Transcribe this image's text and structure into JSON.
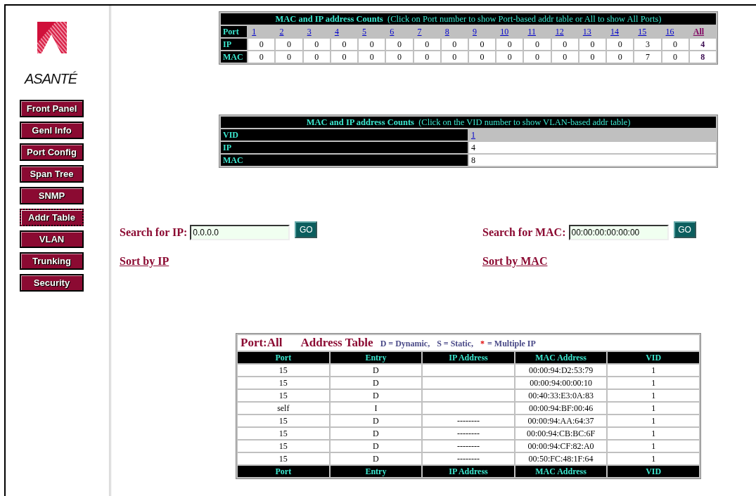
{
  "sidebar": {
    "brand": "ASANTÉ",
    "items": [
      {
        "label": "Front Panel",
        "selected": false
      },
      {
        "label": "Genl Info",
        "selected": false
      },
      {
        "label": "Port Config",
        "selected": false
      },
      {
        "label": "Span Tree",
        "selected": false
      },
      {
        "label": "SNMP",
        "selected": false
      },
      {
        "label": "Addr Table",
        "selected": true
      },
      {
        "label": "VLAN",
        "selected": false
      },
      {
        "label": "Trunking",
        "selected": false
      },
      {
        "label": "Security",
        "selected": false
      }
    ]
  },
  "port_counts": {
    "title": "MAC and IP address Counts",
    "note": "(Click on Port number to show Port-based addr table or All to show All Ports)",
    "header": "Port",
    "ports": [
      "1",
      "2",
      "3",
      "4",
      "5",
      "6",
      "7",
      "8",
      "9",
      "10",
      "11",
      "12",
      "13",
      "14",
      "15",
      "16"
    ],
    "all": "All",
    "rows": [
      {
        "label": "IP",
        "values": [
          "0",
          "0",
          "0",
          "0",
          "0",
          "0",
          "0",
          "0",
          "0",
          "0",
          "0",
          "0",
          "0",
          "0",
          "3",
          "0"
        ],
        "total": "4"
      },
      {
        "label": "MAC",
        "values": [
          "0",
          "0",
          "0",
          "0",
          "0",
          "0",
          "0",
          "0",
          "0",
          "0",
          "0",
          "0",
          "0",
          "0",
          "7",
          "0"
        ],
        "total": "8"
      }
    ]
  },
  "vlan_counts": {
    "title": "MAC and IP address Counts",
    "note": "(Click on the VID number to show VLAN-based addr table)",
    "rows": [
      {
        "label": "VID",
        "value": "1",
        "kind": "link"
      },
      {
        "label": "IP",
        "value": "4",
        "kind": "plain"
      },
      {
        "label": "MAC",
        "value": "8",
        "kind": "plain"
      }
    ]
  },
  "search": [
    {
      "label": "Search for IP:",
      "value": "0.0.0.0",
      "button": "GO",
      "sort_link": "Sort by IP"
    },
    {
      "label": "Search for MAC:",
      "value": "00:00:00:00:00:00",
      "button": "GO",
      "sort_link": "Sort by MAC"
    }
  ],
  "address_table": {
    "port": "Port:All",
    "title": "Address Table",
    "legend": [
      {
        "text": "D = Dynamic,"
      },
      {
        "text": "S = Static,"
      },
      {
        "mark": "*",
        "text": "= Multiple IP"
      }
    ],
    "columns": [
      "Port",
      "Entry",
      "IP Address",
      "MAC Address",
      "VID"
    ],
    "rows": [
      [
        "15",
        "D",
        "",
        "00:00:94:D2:53:79",
        "1"
      ],
      [
        "15",
        "D",
        "",
        "00:00:94:00:00:10",
        "1"
      ],
      [
        "15",
        "D",
        "",
        "00:40:33:E3:0A:83",
        "1"
      ],
      [
        "self",
        "I",
        "",
        "00:00:94:BF:00:46",
        "1"
      ],
      [
        "15",
        "D",
        "--------",
        "00:00:94:AA:64:37",
        "1"
      ],
      [
        "15",
        "D",
        "--------",
        "00:00:94:CB:BC:6F",
        "1"
      ],
      [
        "15",
        "D",
        "--------",
        "00:00:94:CF:82:A0",
        "1"
      ],
      [
        "15",
        "D",
        "--------",
        "00:50:FC:48:1F:64",
        "1"
      ]
    ],
    "footer_columns": [
      "Port",
      "Entry",
      "IP Address",
      "MAC Address",
      "VID"
    ]
  }
}
